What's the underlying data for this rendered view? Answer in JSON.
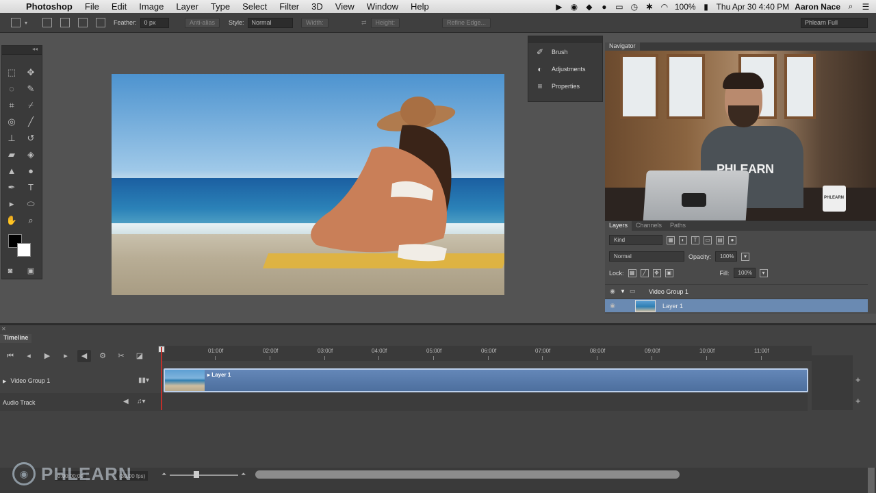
{
  "menubar": {
    "apple": "",
    "app_name": "Photoshop",
    "items": [
      "File",
      "Edit",
      "Image",
      "Layer",
      "Type",
      "Select",
      "Filter",
      "3D",
      "View",
      "Window",
      "Help"
    ],
    "battery": "100%",
    "datetime": "Thu Apr 30  4:40 PM",
    "user": "Aaron Nace"
  },
  "options": {
    "feather_label": "Feather:",
    "feather_value": "0 px",
    "antialias": "Anti-alias",
    "style_label": "Style:",
    "style_value": "Normal",
    "width_label": "Width:",
    "height_label": "Height:",
    "refine_edge": "Refine Edge...",
    "workspace": "Phlearn Full"
  },
  "mini_panel": {
    "items": [
      "Brush",
      "Adjustments",
      "Properties"
    ]
  },
  "navigator": {
    "tab": "Navigator",
    "shirt_text": "PHLEARN",
    "mug_text": "PHLEARN"
  },
  "layers": {
    "tabs": [
      "Layers",
      "Channels",
      "Paths"
    ],
    "filter": "Kind",
    "blend": "Normal",
    "opacity_label": "Opacity:",
    "opacity_value": "100%",
    "lock_label": "Lock:",
    "fill_label": "Fill:",
    "fill_value": "100%",
    "group_name": "Video Group 1",
    "layer_name": "Layer 1"
  },
  "timeline": {
    "tab": "Timeline",
    "ticks": [
      "01:00f",
      "02:00f",
      "03:00f",
      "04:00f",
      "05:00f",
      "06:00f",
      "07:00f",
      "08:00f",
      "09:00f",
      "10:00f",
      "11:00f"
    ],
    "tracks": {
      "video": "Video Group 1",
      "audio": "Audio Track"
    },
    "clip_label": "Layer 1",
    "timecode": "0:00:00:00",
    "fps": "(30.00 fps)"
  },
  "watermark": "PHLEARN"
}
